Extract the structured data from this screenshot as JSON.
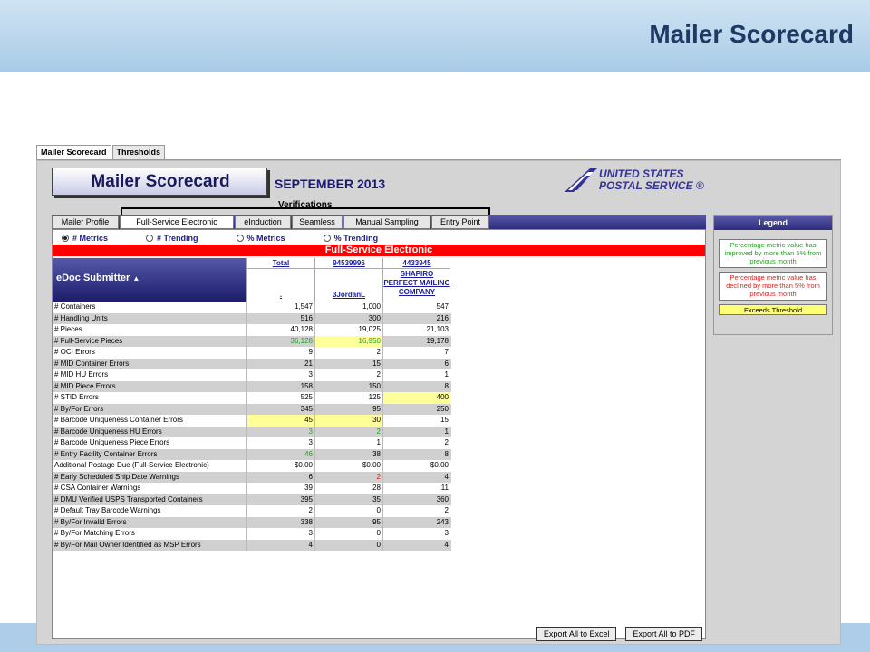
{
  "slide_title": "Mailer Scorecard",
  "tabs": [
    {
      "label": "Mailer Scorecard",
      "active": true
    },
    {
      "label": "Thresholds",
      "active": false
    }
  ],
  "logo_text": "Mailer Scorecard",
  "month": "SEPTEMBER 2013",
  "usps_name_line1": "UNITED STATES",
  "usps_name_line2": "POSTAL SERVICE ®",
  "verifications_label": "Verifications",
  "nav": [
    {
      "label": "Mailer Profile",
      "active": false
    },
    {
      "label": "Full-Service Electronic",
      "active": true
    },
    {
      "label": "eInduction",
      "active": false
    },
    {
      "label": "Seamless",
      "active": false
    },
    {
      "label": "Manual Sampling",
      "active": false
    },
    {
      "label": "Entry Point",
      "active": false
    }
  ],
  "radios": [
    {
      "label": "# Metrics",
      "selected": true
    },
    {
      "label": "# Trending",
      "selected": false
    },
    {
      "label": "% Metrics",
      "selected": false
    },
    {
      "label": "% Trending",
      "selected": false
    }
  ],
  "section_title": "Full-Service Electronic",
  "edoc_label": "eDoc Submitter",
  "columns": [
    {
      "top": "Total",
      "sub": "."
    },
    {
      "top": "94539996",
      "sub": "3JordanL"
    },
    {
      "top": "4433945",
      "sub": "SHAPIRO PERFECT MAILING COMPANY"
    }
  ],
  "rows": [
    {
      "label": "# Containers",
      "v": [
        "1,547",
        "1,000",
        "547"
      ],
      "s": [
        "",
        "",
        ""
      ]
    },
    {
      "label": "# Handling Units",
      "v": [
        "516",
        "300",
        "216"
      ],
      "s": [
        "",
        "",
        ""
      ]
    },
    {
      "label": "# Pieces",
      "v": [
        "40,128",
        "19,025",
        "21,103"
      ],
      "s": [
        "",
        "",
        ""
      ]
    },
    {
      "label": "# Full-Service Pieces",
      "v": [
        "36,128",
        "16,950",
        "19,178"
      ],
      "s": [
        "g",
        "gy",
        ""
      ]
    },
    {
      "label": "# OCI Errors",
      "v": [
        "9",
        "2",
        "7"
      ],
      "s": [
        "",
        "",
        ""
      ]
    },
    {
      "label": "# MID Container Errors",
      "v": [
        "21",
        "15",
        "6"
      ],
      "s": [
        "",
        "",
        ""
      ]
    },
    {
      "label": "# MID HU Errors",
      "v": [
        "3",
        "2",
        "1"
      ],
      "s": [
        "",
        "",
        ""
      ]
    },
    {
      "label": "# MID Piece Errors",
      "v": [
        "158",
        "150",
        "8"
      ],
      "s": [
        "",
        "",
        ""
      ]
    },
    {
      "label": "# STID Errors",
      "v": [
        "525",
        "125",
        "400"
      ],
      "s": [
        "",
        "",
        "y"
      ]
    },
    {
      "label": "# By/For Errors",
      "v": [
        "345",
        "95",
        "250"
      ],
      "s": [
        "",
        "",
        ""
      ]
    },
    {
      "label": "# Barcode Uniqueness Container Errors",
      "v": [
        "45",
        "30",
        "15"
      ],
      "s": [
        "y",
        "y",
        ""
      ]
    },
    {
      "label": "# Barcode Uniqueness HU Errors",
      "v": [
        "3",
        "2",
        "1"
      ],
      "s": [
        "g",
        "g",
        ""
      ]
    },
    {
      "label": "# Barcode Uniqueness Piece Errors",
      "v": [
        "3",
        "1",
        "2"
      ],
      "s": [
        "",
        "",
        ""
      ]
    },
    {
      "label": "# Entry Facility Container Errors",
      "v": [
        "46",
        "38",
        "8"
      ],
      "s": [
        "g",
        "",
        ""
      ]
    },
    {
      "label": "Additional Postage Due (Full-Service Electronic)",
      "v": [
        "$0.00",
        "$0.00",
        "$0.00"
      ],
      "s": [
        "",
        "",
        ""
      ]
    },
    {
      "label": "# Early Scheduled Ship Date Warnings",
      "v": [
        "6",
        "2",
        "4"
      ],
      "s": [
        "",
        "r",
        ""
      ]
    },
    {
      "label": "# CSA Container Warnings",
      "v": [
        "39",
        "28",
        "11"
      ],
      "s": [
        "",
        "",
        ""
      ]
    },
    {
      "label": "# DMU Verified USPS Transported Containers",
      "v": [
        "395",
        "35",
        "360"
      ],
      "s": [
        "",
        "",
        ""
      ]
    },
    {
      "label": "# Default Tray Barcode Warnings",
      "v": [
        "2",
        "0",
        "2"
      ],
      "s": [
        "",
        "",
        ""
      ]
    },
    {
      "label": "# By/For Invalid Errors",
      "v": [
        "338",
        "95",
        "243"
      ],
      "s": [
        "",
        "",
        ""
      ]
    },
    {
      "label": "# By/For Matching Errors",
      "v": [
        "3",
        "0",
        "3"
      ],
      "s": [
        "",
        "",
        ""
      ]
    },
    {
      "label": "# By/For Mail Owner Identified as MSP Errors",
      "v": [
        "4",
        "0",
        "4"
      ],
      "s": [
        "",
        "",
        ""
      ]
    }
  ],
  "legend": {
    "title": "Legend",
    "green": "Percentage metric value has improved by more than 5% from previous month",
    "red": "Percentage metric value has declined by more than 5% from previous month",
    "yellow": "Exceeds Threshold"
  },
  "export_excel": "Export All to Excel",
  "export_pdf": "Export All to PDF"
}
